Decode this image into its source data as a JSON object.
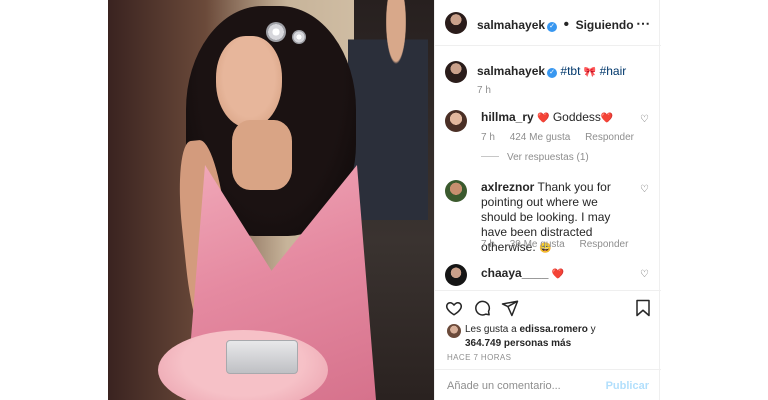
{
  "header": {
    "username": "salmahayek",
    "separator": "•",
    "follow_status": "Siguiendo",
    "more_icon": "more-horizontal-icon"
  },
  "caption": {
    "username": "salmahayek",
    "tags": "#tbt",
    "emoji": "🎀",
    "tags2": "#hair",
    "time": "7 h"
  },
  "comments": [
    {
      "username": "hillma_ry",
      "text": "Goddess",
      "emoji": "❤️",
      "time": "7 h",
      "likes": "424 Me gusta",
      "reply": "Responder"
    },
    {
      "username": "axlreznor",
      "text": "Thank you for pointing out where we should be looking. I may have been distracted otherwise.",
      "emoji": "😄",
      "time": "7 h",
      "likes": "39 Me gusta",
      "reply": "Responder"
    },
    {
      "username": "chaaya____",
      "emoji": "❤️"
    }
  ],
  "replies_link": "Ver respuestas (1)",
  "likes": {
    "prefix": "Les gusta a",
    "user": "edissa.romero",
    "joiner": "y",
    "count": "364.749 personas más"
  },
  "post_time": "HACE 7 HORAS",
  "add_comment": {
    "placeholder": "Añade un comentario...",
    "submit": "Publicar"
  },
  "colors": {
    "verified_blue": "#3897f0",
    "link_blue": "#00376b",
    "muted": "#8e8e8e",
    "publish_disabled": "#b2dffc"
  }
}
